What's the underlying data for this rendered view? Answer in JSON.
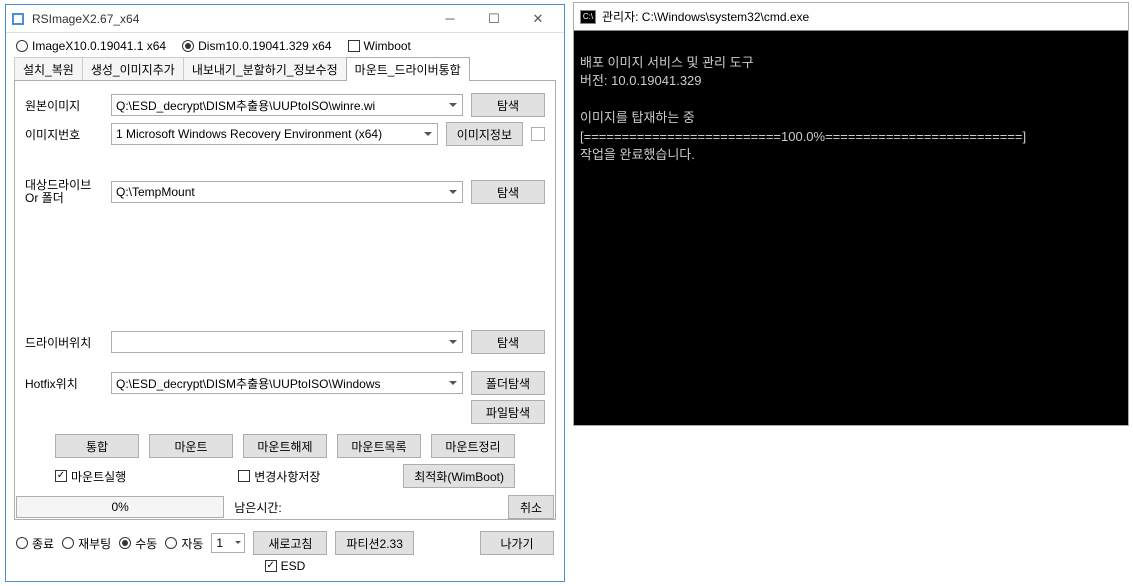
{
  "app": {
    "title": "RSImageX2.67_x64",
    "toolbar": {
      "imagex": {
        "label": "ImageX10.0.19041.1 x64",
        "checked": false
      },
      "dism": {
        "label": "Dism10.0.19041.329 x64",
        "checked": true
      },
      "wimboot": {
        "label": "Wimboot",
        "checked": false
      }
    },
    "tabs": {
      "install": "설치_복원",
      "create": "생성_이미지추가",
      "export": "내보내기_분할하기_정보수정",
      "mount": "마운트_드라이버통합"
    },
    "panel": {
      "source_label": "원본이미지",
      "source_value": "Q:\\ESD_decrypt\\DISM추출용\\UUPtoISO\\winre.wi",
      "browse": "탐색",
      "index_label": "이미지번호",
      "index_value": "1  Microsoft Windows Recovery Environment (x64)",
      "image_info": "이미지정보",
      "target_label": "대상드라이브\nOr 폴더",
      "target_value": "Q:\\TempMount",
      "driver_label": "드라이버위치",
      "driver_value": "",
      "hotfix_label": "Hotfix위치",
      "hotfix_value": "Q:\\ESD_decrypt\\DISM추출용\\UUPtoISO\\Windows",
      "folder_browse": "폴더탐색",
      "file_browse": "파일탐색",
      "btn_integrate": "통합",
      "btn_mount": "마운트",
      "btn_unmount": "마운트해제",
      "btn_mount_list": "마운트목록",
      "btn_mount_cleanup": "마운트정리",
      "chk_mount_exec": "마운트실행",
      "chk_save_changes": "변경사항저장",
      "btn_optimize": "최적화(WimBoot)"
    },
    "footer": {
      "progress": "0%",
      "remaining_label": "남은시간:",
      "cancel": "취소",
      "shutdown": "종료",
      "reboot": "재부팅",
      "manual": "수동",
      "auto": "자동",
      "num": "1",
      "refresh": "새로고침",
      "partition": "파티션2.33",
      "exit": "나가기",
      "esd": "ESD"
    }
  },
  "console": {
    "title": "관리자: C:\\Windows\\system32\\cmd.exe",
    "lines": [
      "",
      "배포 이미지 서비스 및 관리 도구",
      "버전: 10.0.19041.329",
      "",
      "이미지를 탑재하는 중",
      "[==========================100.0%==========================]",
      "작업을 완료했습니다."
    ]
  }
}
